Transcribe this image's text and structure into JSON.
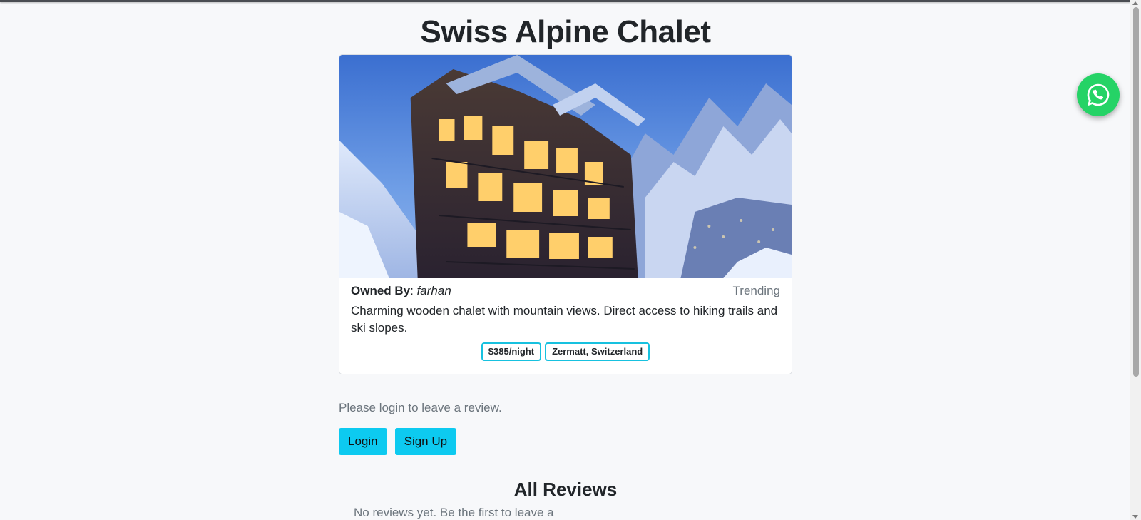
{
  "listing": {
    "title": "Swiss Alpine Chalet",
    "image_alt": "Swiss Alpine Chalet",
    "owner_label": "Owned By",
    "owner_sep": ": ",
    "owner_name": "farhan",
    "badge": "Trending",
    "description": "Charming wooden chalet with mountain views. Direct access to hiking trails and ski slopes.",
    "price": "$385/night",
    "location": "Zermatt, Switzerland"
  },
  "review_section": {
    "login_prompt": "Please login to leave a review.",
    "login_button": "Login",
    "signup_button": "Sign Up"
  },
  "reviews": {
    "heading": "All Reviews",
    "empty_text": "No reviews yet. Be the first to leave a"
  },
  "floating": {
    "icon": "whatsapp-icon"
  },
  "colors": {
    "accent": "#0dcaf0",
    "whatsapp": "#25d366",
    "tag_border": "#17c1df"
  }
}
